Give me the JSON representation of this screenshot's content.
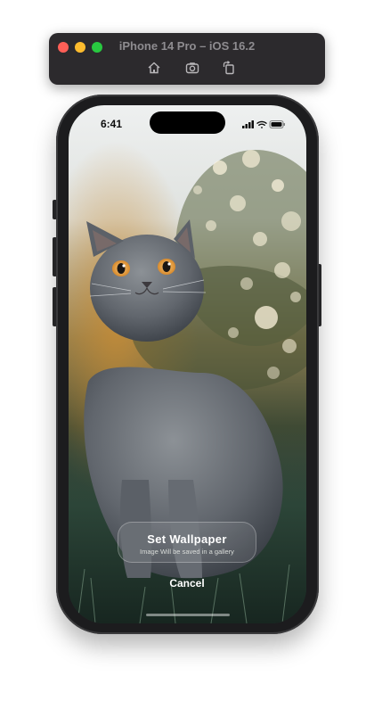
{
  "simulator": {
    "title": "iPhone 14 Pro – iOS 16.2",
    "toolbar_icons": [
      "home-icon",
      "screenshot-icon",
      "rotate-icon"
    ],
    "window_controls": [
      "close",
      "minimize",
      "zoom"
    ]
  },
  "status_bar": {
    "time": "6:41",
    "icons": [
      "cellular-signal-icon",
      "wifi-icon",
      "battery-icon"
    ]
  },
  "wallpaper": {
    "subject": "gray cat sitting in grass with bokeh background"
  },
  "dialog": {
    "set_button_label": "Set Wallpaper",
    "set_button_subtitle": "Image Will be saved in a gallery",
    "cancel_label": "Cancel"
  },
  "colors": {
    "toolbar_bg": "#2c2a2d",
    "close": "#ff5f57",
    "minimize": "#febc2e",
    "zoom": "#28c840",
    "text_on_wallpaper": "#ffffff"
  }
}
